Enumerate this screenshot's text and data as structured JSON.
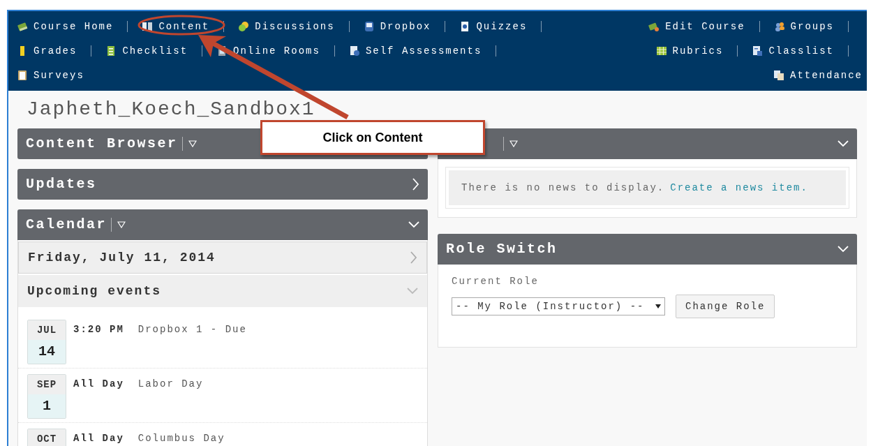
{
  "navbar": {
    "rows": [
      {
        "left": [
          {
            "label": "Course Home",
            "separator_after": true
          },
          {
            "label": "Content",
            "separator_after": true
          },
          {
            "label": "Discussions",
            "separator_after": true
          },
          {
            "label": "Dropbox",
            "separator_after": true
          },
          {
            "label": "Quizzes",
            "separator_after": true
          }
        ],
        "right": [
          {
            "label": "Edit Course",
            "separator_after": true
          },
          {
            "label": "Groups",
            "separator_after": true
          }
        ]
      },
      {
        "left": [
          {
            "label": "Grades",
            "separator_after": true
          },
          {
            "label": "Checklist",
            "separator_after": true
          },
          {
            "label": "Online Rooms",
            "separator_after": true
          },
          {
            "label": "Self Assessments",
            "separator_after": true
          }
        ],
        "right": [
          {
            "label": "Rubrics",
            "separator_after": true
          },
          {
            "label": "Classlist",
            "separator_after": true
          }
        ]
      },
      {
        "left": [
          {
            "label": "Surveys",
            "separator_after": false
          }
        ],
        "right": [
          {
            "label": "Attendance",
            "separator_after": false
          }
        ]
      }
    ]
  },
  "course_title": "Japheth_Koech_Sandbox1",
  "left_column": {
    "content_browser": {
      "title": "Content Browser"
    },
    "updates": {
      "title": "Updates",
      "expanded": false
    },
    "calendar": {
      "title": "Calendar",
      "expanded": true,
      "date": "Friday, July 11, 2014",
      "upcoming_title": "Upcoming events",
      "events": [
        {
          "month": "JUL",
          "day": "14",
          "time": "3:20 PM",
          "name": "Dropbox 1 - Due"
        },
        {
          "month": "SEP",
          "day": "1",
          "time": "All Day",
          "name": "Labor Day"
        },
        {
          "month": "OCT",
          "time": "All Day",
          "name": "Columbus Day"
        }
      ]
    }
  },
  "right_column": {
    "news": {
      "expanded": true,
      "message": "There is no news to display.",
      "link": "Create a news item."
    },
    "role_switch": {
      "title": "Role Switch",
      "expanded": true,
      "label": "Current Role",
      "select_value": "-- My Role (Instructor) --",
      "button": "Change Role"
    }
  },
  "annotation": {
    "callout": "Click on Content"
  }
}
